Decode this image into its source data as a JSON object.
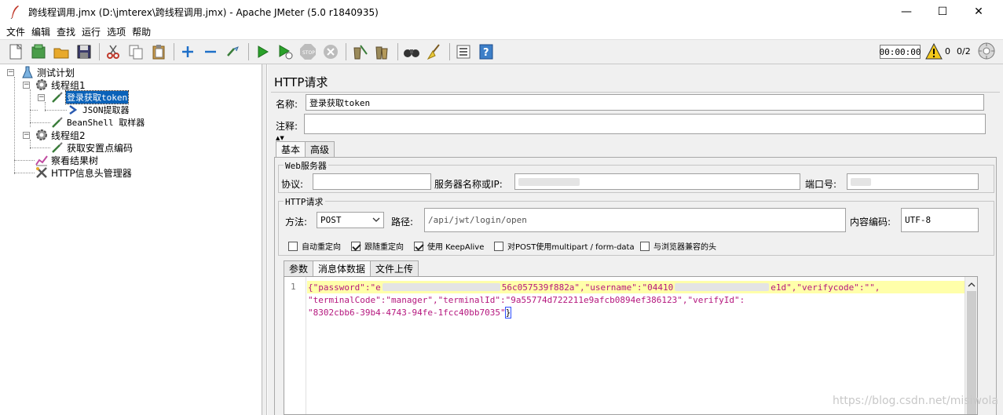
{
  "window": {
    "title": "跨线程调用.jmx (D:\\jmterex\\跨线程调用.jmx) - Apache JMeter (5.0 r1840935)",
    "controls": {
      "minimize": "—",
      "maximize": "☐",
      "close": "✕"
    }
  },
  "menu": [
    "文件",
    "编辑",
    "查找",
    "运行",
    "选项",
    "帮助"
  ],
  "toolbar": {
    "timer": "00:00:00",
    "warning_count": "0",
    "threads": "0/2"
  },
  "tree": {
    "items": [
      {
        "label": "测试计划"
      },
      {
        "label": "线程组1"
      },
      {
        "label": "登录获取token"
      },
      {
        "label": "JSON提取器"
      },
      {
        "label": "BeanShell 取样器"
      },
      {
        "label": "线程组2"
      },
      {
        "label": "获取安置点编码"
      },
      {
        "label": "察看结果树"
      },
      {
        "label": "HTTP信息头管理器"
      }
    ]
  },
  "panel": {
    "title": "HTTP请求",
    "name_label": "名称:",
    "name_value": "登录获取token",
    "comment_label": "注释:",
    "tabs": [
      "基本",
      "高级"
    ],
    "web_server": {
      "group_title": "Web服务器",
      "protocol_label": "协议:",
      "server_label": "服务器名称或IP:",
      "port_label": "端口号:"
    },
    "http_request": {
      "group_title": "HTTP请求",
      "method_label": "方法:",
      "method_value": "POST",
      "path_label": "路径:",
      "path_value": "/api/jwt/login/open",
      "encoding_label": "内容编码:",
      "encoding_value": "UTF-8"
    },
    "checkboxes": [
      {
        "label": "自动重定向",
        "checked": false
      },
      {
        "label": "跟随重定向",
        "checked": true
      },
      {
        "label": "使用 KeepAlive",
        "checked": true
      },
      {
        "label": "对POST使用multipart / form-data",
        "checked": false
      },
      {
        "label": "与浏览器兼容的头",
        "checked": false
      }
    ],
    "body_tabs": [
      "参数",
      "消息体数据",
      "文件上传"
    ]
  },
  "editor": {
    "line_number": "1",
    "line1": {
      "a": "{\"password\":\"e",
      "b": "56c057539f882a\",\"username\":\"04410",
      "c": "e1d\",\"verifycode\":\"\","
    },
    "line2": "\"terminalCode\":\"manager\",\"terminalId\":\"9a55774d722211e9afcb0894ef386123\",\"verifyId\":",
    "line3": "\"8302cbb6-39b4-4743-94fe-1fcc40bb7035\"",
    "closing": "}"
  },
  "watermark": "https://blog.csdn.net/misiwola"
}
